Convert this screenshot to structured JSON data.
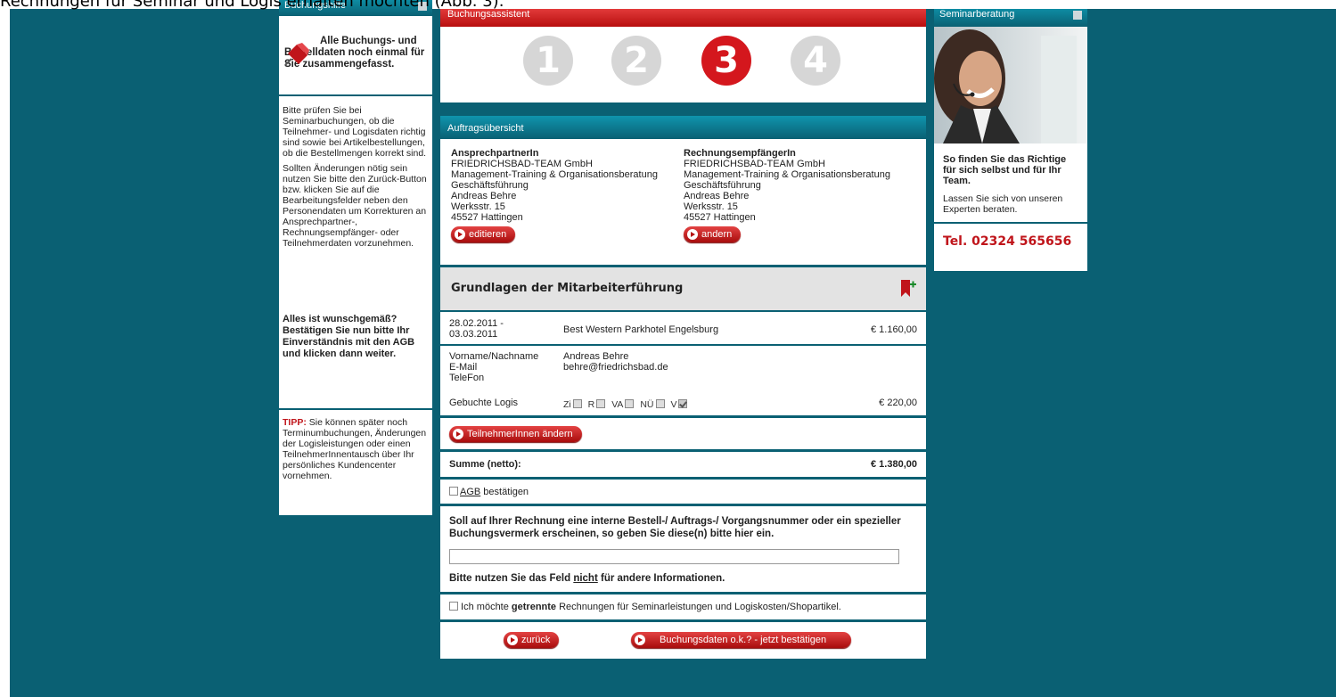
{
  "caption": "Rechnungen für Seminar und Logis erhalten möchten (Abb. 3).",
  "left": {
    "title": "Buchungshilfe",
    "intro": "Alle Buchungs- und Bestelldaten noch einmal für Sie zusammengefasst.",
    "p1": "Bitte prüfen Sie bei Seminarbuchungen, ob die Teilnehmer- und Logisdaten richtig sind sowie bei Artikelbestellungen, ob die Bestellmengen korrekt sind.",
    "p2": "Sollten Änderungen nötig sein nutzen Sie bitte den Zurück-Button bzw. klicken Sie auf die Bearbeitungsfelder neben den Personendaten um Korrekturen an Ansprechpartner-, Rechnungsempfänger- oder Teilnehmerdaten vorzunehmen.",
    "p3": "Alles ist wunschgemäß? Bestätigen Sie nun bitte Ihr Einverständnis mit den AGB und klicken dann weiter.",
    "tipp_label": "TIPP:",
    "tipp_text": " Sie können später noch Terminumbuchungen, Änderungen der Logisleistungen oder einen TeilnehmerInnentausch über Ihr persönliches Kundencenter vornehmen."
  },
  "main": {
    "assistant_title": "Buchungsassistent",
    "steps": [
      "1",
      "2",
      "3",
      "4"
    ],
    "active_step": 3,
    "overview_title": "Auftragsübersicht",
    "contact": {
      "heading": "AnsprechpartnerIn",
      "lines": [
        "FRIEDRICHSBAD-TEAM GmbH",
        "Management-Training & Organisationsberatung",
        "Geschäftsführung",
        "Andreas Behre",
        "Werksstr. 15",
        "45527 Hattingen"
      ],
      "button": "editieren"
    },
    "billing": {
      "heading": "RechnungsempfängerIn",
      "lines": [
        "FRIEDRICHSBAD-TEAM GmbH",
        "Management-Training & Organisationsberatung",
        "Geschäftsführung",
        "Andreas Behre",
        "Werksstr. 15",
        "45527 Hattingen"
      ],
      "button": "andern"
    },
    "seminar": {
      "title": "Grundlagen der Mitarbeiterführung",
      "date": "28.02.2011 - 03.03.2011",
      "hotel": "Best Western Parkhotel Engelsburg",
      "price": "€ 1.160,00",
      "labels": [
        "Vorname/Nachname",
        "E-Mail",
        "TeleFon"
      ],
      "values": [
        "Andreas Behre",
        "behre@friedrichsbad.de",
        ""
      ],
      "logis_label": "Gebuchte Logis",
      "logis_opts": [
        "Zi",
        "R",
        "VA",
        "NÜ",
        "V"
      ],
      "logis_price": "€ 220,00",
      "participants_button": "TeilnehmerInnen ändern"
    },
    "sum_label": "Summe (netto):",
    "sum_value": "€ 1.380,00",
    "agb_link": "AGB",
    "agb_rest": " bestätigen",
    "order_question": "Soll auf Ihrer Rechnung eine interne Bestell-/ Auftrags-/ Vorgangsnummer oder ein spezieller Buchungsvermerk erscheinen, so geben Sie diese(n) bitte hier ein.",
    "order_value": "",
    "note_pre": "Bitte nutzen Sie das Feld ",
    "note_em": "nicht",
    "note_post": " für andere Informationen.",
    "separate_pre": " Ich möchte ",
    "separate_bold": "getrennte",
    "separate_post": " Rechnungen für Seminarleistungen und Logiskosten/Shopartikel.",
    "back_button": "zurück",
    "confirm_button": "Buchungsdaten o.k.? - jetzt bestätigen"
  },
  "right": {
    "title": "Seminarberatung",
    "headline": "So finden Sie das Richtige für sich selbst und für Ihr Team.",
    "text": "Lassen Sie sich von unseren Experten beraten.",
    "phone": "Tel. 02324 565656"
  },
  "colors": {
    "background": "#0a6073",
    "accent_red": "#c0151b",
    "teal": "#0e8ca3"
  },
  "icons": [
    "pushpin-icon",
    "bookmark-add-icon",
    "arrow-right-icon",
    "advisor-photo"
  ]
}
